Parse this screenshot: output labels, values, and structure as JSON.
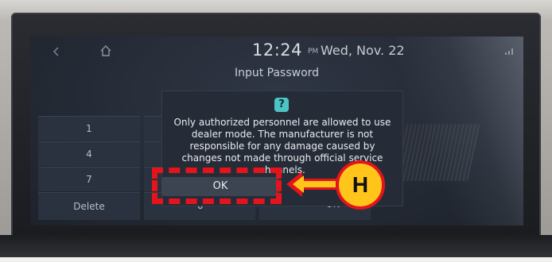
{
  "statusbar": {
    "back_icon": "chevron-left-icon",
    "home_icon": "home-icon",
    "time": "12:24",
    "ampm": "PM",
    "date": "Wed, Nov. 22",
    "signal_icon": "signal-icon"
  },
  "page": {
    "title": "Input Password"
  },
  "keypad": {
    "keys": [
      "1",
      "4",
      "7",
      "Delete"
    ],
    "bottom_zero": "0",
    "bottom_ok": "OK"
  },
  "dialog": {
    "icon": "help-icon",
    "icon_glyph": "?",
    "message": "Only authorized personnel are allowed to use dealer mode. The manufacturer is not responsible for any damage caused by changes not made through official service channels.",
    "ok_label": "OK"
  },
  "annotation": {
    "badge_label": "H",
    "highlight_color": "#e3141c",
    "badge_color": "#ffc51a"
  }
}
